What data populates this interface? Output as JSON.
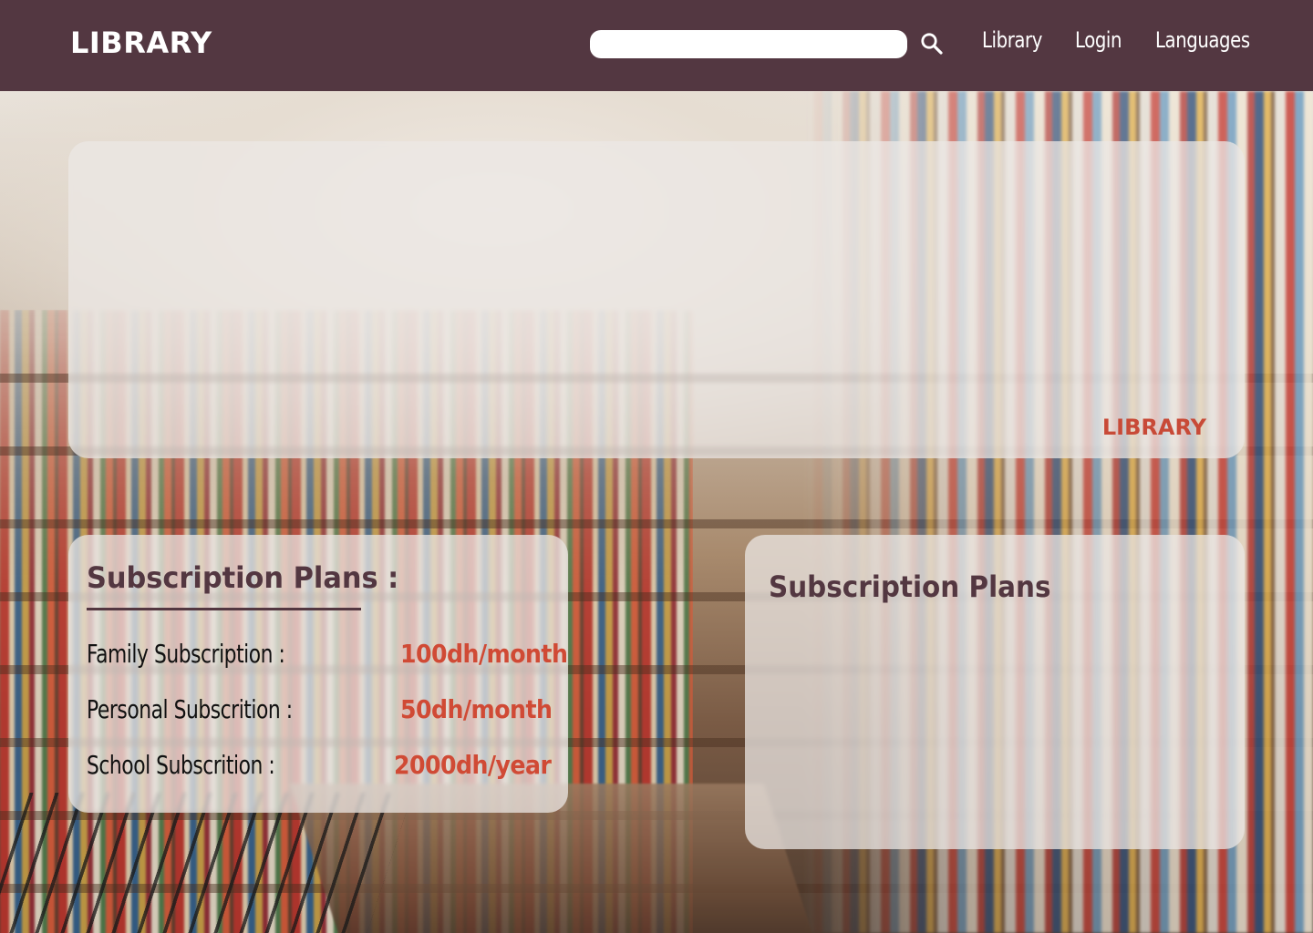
{
  "header": {
    "brand": "LIBRARY",
    "search": {
      "value": "",
      "placeholder": ""
    },
    "search_icon": "search-icon",
    "nav": {
      "library": "Library",
      "login": "Login",
      "languages": "Languages"
    }
  },
  "hero": {
    "tag": "LIBRARY"
  },
  "plans_card": {
    "title": "Subscription Plans :",
    "rows": [
      {
        "name": "Family Subscription :",
        "price": "100dh/month"
      },
      {
        "name": "Personal Subscrition :",
        "price": "50dh/month"
      },
      {
        "name": "School Subscrition :",
        "price": "2000dh/year"
      }
    ]
  },
  "plans_card_2": {
    "title": "Subscription Plans"
  },
  "colors": {
    "header_bg": "#533741",
    "accent_red": "#d04a35",
    "title_plum": "#533741",
    "card_glass": "rgba(236,232,230,0.74)"
  }
}
